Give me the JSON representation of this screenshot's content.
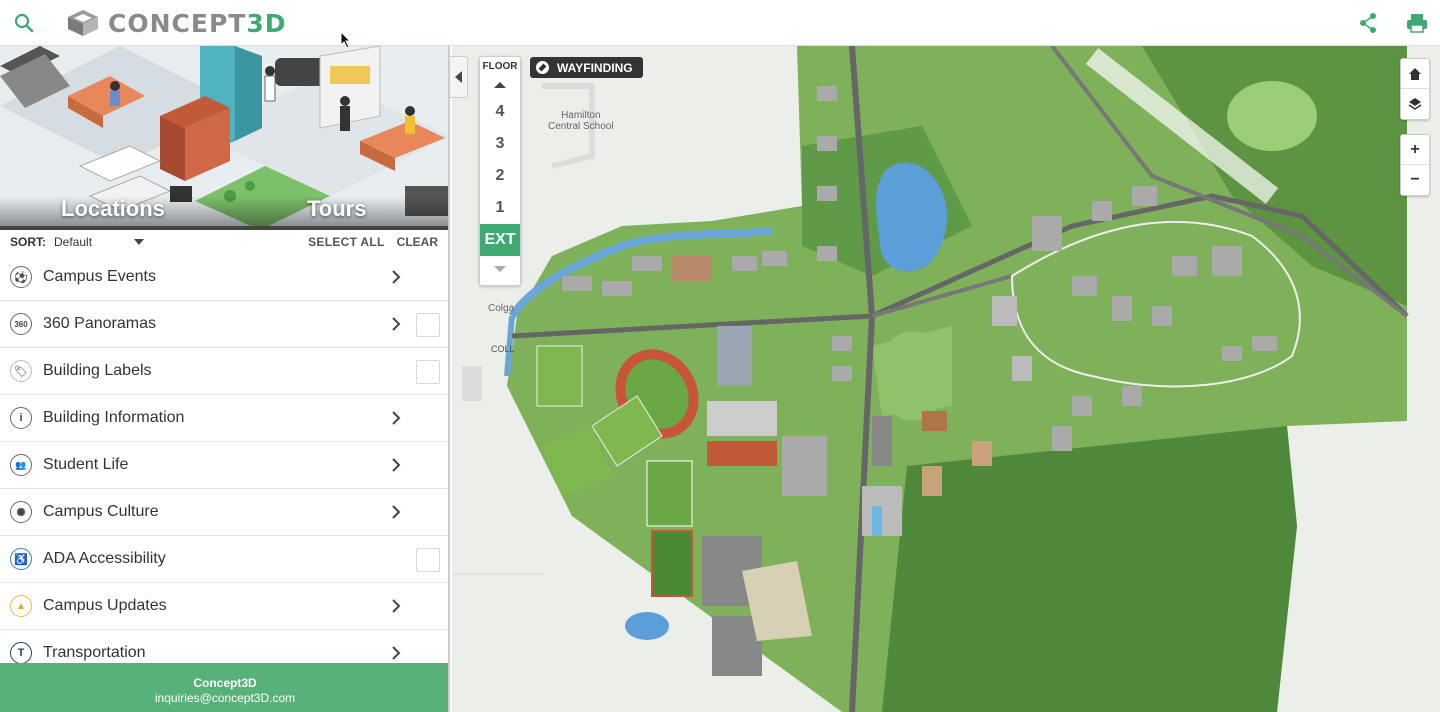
{
  "brand": {
    "logo_text_main": "CONCEPT",
    "logo_text_accent": "3D"
  },
  "colors": {
    "accent": "#3eaa72",
    "footer": "#57b27a",
    "map_green": "#7fb05a",
    "map_bg": "#eceeea"
  },
  "topbar": {
    "search_icon": "search-icon",
    "share_icon": "share-icon",
    "print_icon": "print-icon"
  },
  "hero": {
    "tab_locations": "Locations",
    "tab_tours": "Tours"
  },
  "sortbar": {
    "sort_label": "SORT:",
    "sort_value": "Default",
    "select_all": "SELECT ALL",
    "clear": "CLEAR"
  },
  "categories": [
    {
      "label": "Campus Events",
      "icon": "⚽"
    },
    {
      "label": "360 Panoramas",
      "icon": "360"
    },
    {
      "label": "Building Labels",
      "icon": "🏷"
    },
    {
      "label": "Building Information",
      "icon": "i"
    },
    {
      "label": "Student Life",
      "icon": "👥"
    },
    {
      "label": "Campus Culture",
      "icon": "✺"
    },
    {
      "label": "ADA Accessibility",
      "icon": "♿"
    },
    {
      "label": "Campus Updates",
      "icon": "▲"
    },
    {
      "label": "Transportation",
      "icon": "T"
    }
  ],
  "footer": {
    "name": "Concept3D",
    "email": "inquiries@concept3D.com"
  },
  "floor": {
    "title": "FLOOR",
    "floors": [
      "4",
      "3",
      "2",
      "1",
      "EXT"
    ],
    "active": "EXT"
  },
  "wayfinding": {
    "label": "WAYFINDING"
  },
  "map_labels": {
    "school_line1": "Hamilton",
    "school_line2": "Central School",
    "colgate": "Colga",
    "road": "COLL"
  }
}
